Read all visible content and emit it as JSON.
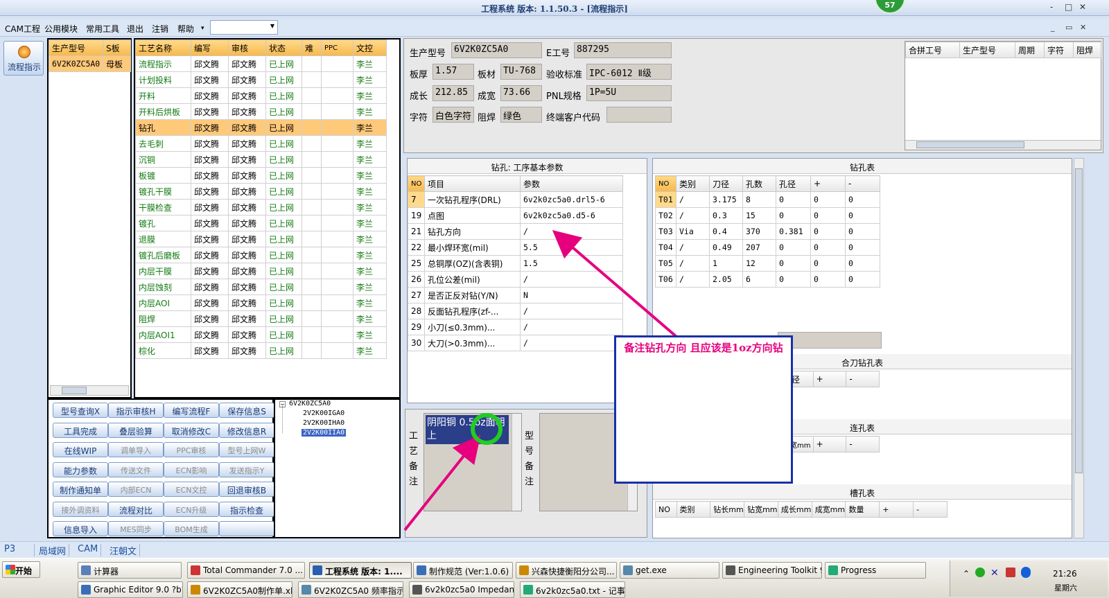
{
  "window": {
    "title": "工程系统  版本: 1.1.50.3 - [流程指示]",
    "badge": "57",
    "min": "-",
    "max": "□",
    "close": "✕",
    "inner_min": "_",
    "inner_max": "▭",
    "inner_close": "✕"
  },
  "menu": [
    "CAM工程",
    "公用模块",
    "常用工具",
    "退出",
    "注销",
    "帮助"
  ],
  "menu_more": "▾",
  "side": {
    "flow_btn": "流程指示"
  },
  "model_list": {
    "headers": [
      "生产型号",
      "S板"
    ],
    "rows": [
      [
        "6V2K0ZC5A0",
        "母板"
      ]
    ]
  },
  "process": {
    "headers": [
      "工艺名称",
      "编写",
      "审核",
      "状态",
      "难",
      "PPC",
      "文控"
    ],
    "rows": [
      [
        "流程指示",
        "邱文腾",
        "邱文腾",
        "已上网",
        "",
        "",
        "李兰"
      ],
      [
        "计划投料",
        "邱文腾",
        "邱文腾",
        "已上网",
        "",
        "",
        "李兰"
      ],
      [
        "开料",
        "邱文腾",
        "邱文腾",
        "已上网",
        "",
        "",
        "李兰"
      ],
      [
        "开料后烘板",
        "邱文腾",
        "邱文腾",
        "已上网",
        "",
        "",
        "李兰"
      ],
      [
        "钻孔",
        "邱文腾",
        "邱文腾",
        "已上网",
        "",
        "",
        "李兰"
      ],
      [
        "去毛刺",
        "邱文腾",
        "邱文腾",
        "已上网",
        "",
        "",
        "李兰"
      ],
      [
        "沉铜",
        "邱文腾",
        "邱文腾",
        "已上网",
        "",
        "",
        "李兰"
      ],
      [
        "板镀",
        "邱文腾",
        "邱文腾",
        "已上网",
        "",
        "",
        "李兰"
      ],
      [
        "镀孔干膜",
        "邱文腾",
        "邱文腾",
        "已上网",
        "",
        "",
        "李兰"
      ],
      [
        "干膜检查",
        "邱文腾",
        "邱文腾",
        "已上网",
        "",
        "",
        "李兰"
      ],
      [
        "镀孔",
        "邱文腾",
        "邱文腾",
        "已上网",
        "",
        "",
        "李兰"
      ],
      [
        "退膜",
        "邱文腾",
        "邱文腾",
        "已上网",
        "",
        "",
        "李兰"
      ],
      [
        "镀孔后磨板",
        "邱文腾",
        "邱文腾",
        "已上网",
        "",
        "",
        "李兰"
      ],
      [
        "内层干膜",
        "邱文腾",
        "邱文腾",
        "已上网",
        "",
        "",
        "李兰"
      ],
      [
        "内层蚀刻",
        "邱文腾",
        "邱文腾",
        "已上网",
        "",
        "",
        "李兰"
      ],
      [
        "内层AOI",
        "邱文腾",
        "邱文腾",
        "已上网",
        "",
        "",
        "李兰"
      ],
      [
        "阻焊",
        "邱文腾",
        "邱文腾",
        "已上网",
        "",
        "",
        "李兰"
      ],
      [
        "内层AOI1",
        "邱文腾",
        "邱文腾",
        "已上网",
        "",
        "",
        "李兰"
      ],
      [
        "棕化",
        "邱文腾",
        "邱文腾",
        "已上网",
        "",
        "",
        "李兰"
      ]
    ]
  },
  "buttons": [
    [
      "型号查询X",
      "指示审核H",
      "编写流程F",
      "保存信息S"
    ],
    [
      "工具完成",
      "叠层验算",
      "取消修改C",
      "修改信息R"
    ],
    [
      "在线WIP",
      "调单导入",
      "PPC审核",
      "型号上网W"
    ],
    [
      "能力参数",
      "传送文件",
      "ECN影响",
      "发送指示Y"
    ],
    [
      "制作通知单",
      "内部ECN",
      "ECN文控",
      "回退审核B"
    ],
    [
      "接外调资料",
      "流程对比",
      "ECN升级",
      "指示检查"
    ],
    [
      "信息导入",
      "MES同步",
      "BOM生成",
      ""
    ]
  ],
  "tree": {
    "root": "6V2K0ZC5A0",
    "children": [
      "2V2K00IGA0",
      "2V2K00IHA0",
      "2V2K00IIA0"
    ],
    "expander": "−"
  },
  "info": {
    "f_model_l": "生产型号",
    "f_model_v": "6V2K0ZC5A0",
    "f_e_l": "E工号",
    "f_e_v": "887295",
    "f_thk_l": "板厚",
    "f_thk_v": "1.57",
    "f_mat_l": "板材",
    "f_mat_v": "TU-768",
    "f_std_l": "验收标准",
    "f_std_v": "IPC-6012 Ⅱ级",
    "f_len_l": "成长",
    "f_len_v": "212.85",
    "f_wid_l": "成宽",
    "f_wid_v": "73.66",
    "f_pnl_l": "PNL规格",
    "f_pnl_v": "1P=5U",
    "f_char_l": "字符",
    "f_char_v": "白色字符",
    "f_sm_l": "阻焊",
    "f_sm_v": "绿色",
    "f_cust_l": "终端客户代码",
    "f_cust_v": ""
  },
  "merge": {
    "headers": [
      "合拼工号",
      "生产型号",
      "周期",
      "字符",
      "阻焊"
    ]
  },
  "params": {
    "title": "钻孔: 工序基本参数",
    "headers": [
      "NO",
      "项目",
      "参数"
    ],
    "rows": [
      [
        "7",
        "一次钻孔程序(DRL)",
        "6v2k0zc5a0.drl5-6"
      ],
      [
        "19",
        "点图",
        "6v2k0zc5a0.d5-6"
      ],
      [
        "21",
        "钻孔方向",
        "/"
      ],
      [
        "22",
        "最小焊环宽(mil)",
        "5.5"
      ],
      [
        "25",
        "总铜厚(OZ)(含表铜)",
        "1.5"
      ],
      [
        "26",
        "孔位公差(mil)",
        "/"
      ],
      [
        "27",
        "是否正反对钻(Y/N)",
        "N"
      ],
      [
        "28",
        "反面钻孔程序(zf-...",
        "/"
      ],
      [
        "29",
        "小刀(≤0.3mm)...",
        "/"
      ],
      [
        "30",
        "大刀(>0.3mm)...",
        "/"
      ]
    ]
  },
  "drill": {
    "title": "钻孔表",
    "headers": [
      "NO",
      "类别",
      "刀径",
      "孔数",
      "孔径",
      "+",
      "-"
    ],
    "rows": [
      [
        "T01",
        "/",
        "3.175",
        "8",
        "0",
        "0",
        "0"
      ],
      [
        "T02",
        "/",
        "0.3",
        "15",
        "0",
        "0",
        "0"
      ],
      [
        "T03",
        "Via",
        "0.4",
        "370",
        "0.381",
        "0",
        "0"
      ],
      [
        "T04",
        "/",
        "0.49",
        "207",
        "0",
        "0",
        "0"
      ],
      [
        "T05",
        "/",
        "1",
        "12",
        "0",
        "0",
        "0"
      ],
      [
        "T06",
        "/",
        "2.05",
        "6",
        "0",
        "0",
        "0"
      ]
    ]
  },
  "combo_drill": {
    "title": "合刀钻孔表",
    "headers": [
      "孔径",
      "+",
      "-"
    ]
  },
  "connect": {
    "title": "连孔表",
    "headers": [
      "成宽mm",
      "+",
      "-"
    ]
  },
  "slot": {
    "title": "槽孔表",
    "headers": [
      "NO",
      "类别",
      "钻长mm",
      "钻宽mm",
      "成长mm",
      "成宽mm",
      "数量",
      "+",
      "-"
    ]
  },
  "memo": {
    "proc_label": "工艺备注",
    "proc_text": "阴阳铜 0.5oz面朝上",
    "model_label": "型号备注"
  },
  "annotation": {
    "text": "备注钻孔方向   且应该是1oz方向钻"
  },
  "status_tabs": [
    "P3",
    "局域网",
    "CAM",
    "汪朝文"
  ],
  "taskbar": {
    "start": "开始",
    "row1": [
      "计算器",
      "Total Commander 7.0 ...",
      "工程系统  版本: 1....",
      "制作规范 (Ver:1.0.6)",
      "兴森快捷衡阳分公司...",
      "get.exe",
      "Engineering Toolkit 9.0...",
      "Progress"
    ],
    "row2": [
      "Graphic Editor 9.0 ?b?2 (0...",
      "6V2K0ZC5A0制作单.xls",
      "6V2K0ZC5A0 频率指示...",
      "6v2k0zc5a0 Impedance...",
      "6v2k0zc5a0.txt - 记事本"
    ],
    "clock": "21:26",
    "weekday": "星期六"
  },
  "colors": {
    "accent": "#1f3f73",
    "annotation": "#e6007e",
    "circle": "#22cc22",
    "memo_border": "#1a2fa8"
  }
}
